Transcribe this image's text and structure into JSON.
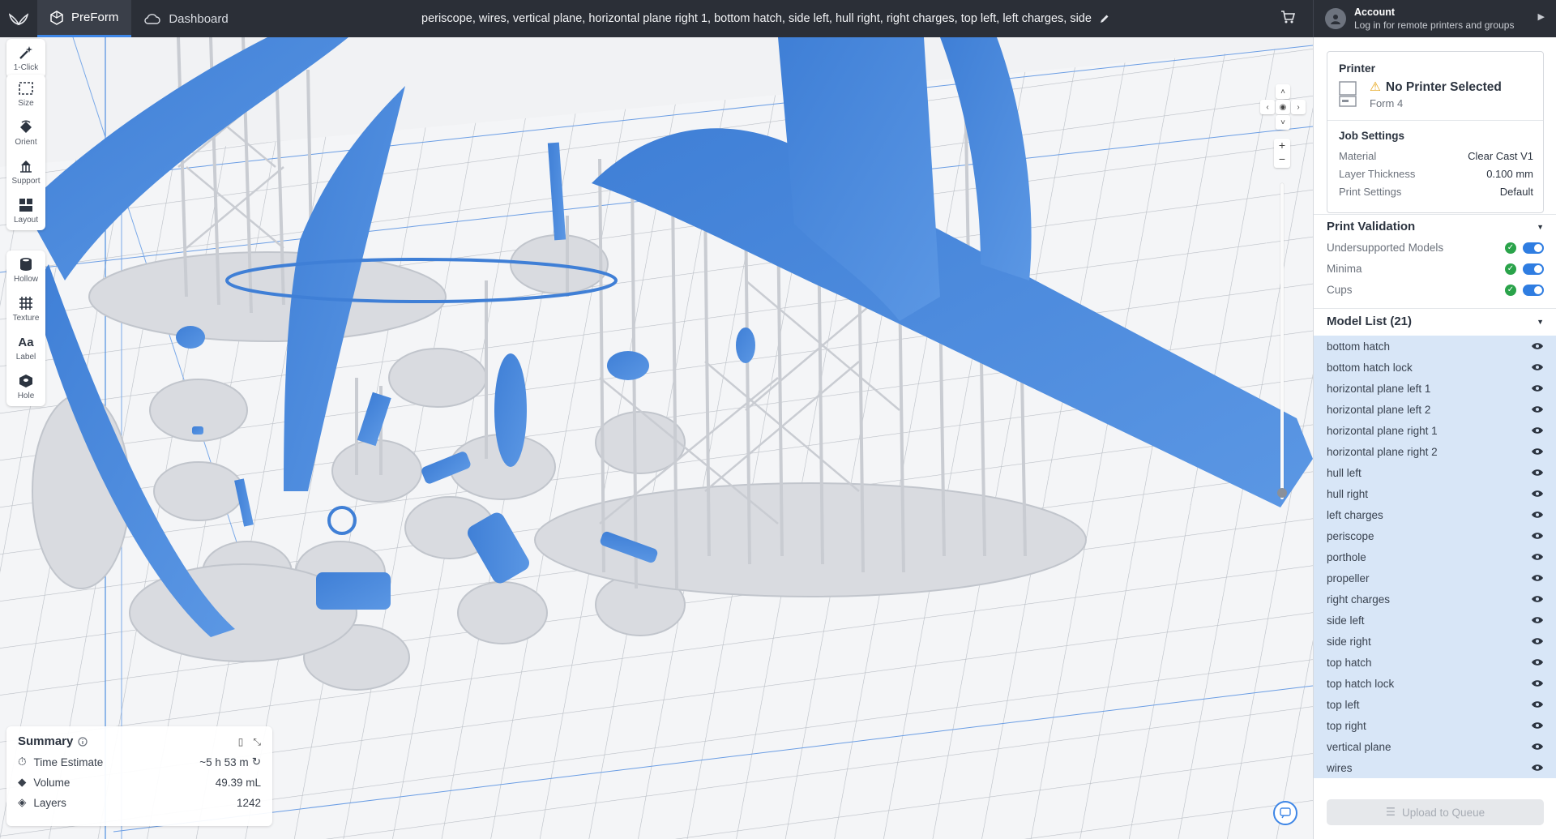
{
  "topbar": {
    "tabs": [
      {
        "label": "PreForm",
        "icon": "preform-cube-icon"
      },
      {
        "label": "Dashboard",
        "icon": "cloud-icon"
      }
    ],
    "document_title": "periscope, wires, vertical plane, horizontal plane right 1, bottom hatch, side left, hull right, right charges, top left, left charges, side",
    "account": {
      "title": "Account",
      "subtitle": "Log in for remote printers and groups"
    }
  },
  "tools": {
    "group1": [
      {
        "label": "1-Click",
        "icon": "magic-wand-icon"
      }
    ],
    "group2": [
      {
        "label": "Size",
        "icon": "size-icon"
      },
      {
        "label": "Orient",
        "icon": "orient-icon"
      },
      {
        "label": "Support",
        "icon": "support-icon"
      },
      {
        "label": "Layout",
        "icon": "layout-icon"
      }
    ],
    "group3": [
      {
        "label": "Hollow",
        "icon": "hollow-icon"
      },
      {
        "label": "Texture",
        "icon": "texture-icon"
      },
      {
        "label": "Label",
        "icon": "label-icon"
      },
      {
        "label": "Hole",
        "icon": "hole-icon"
      }
    ]
  },
  "summary": {
    "title": "Summary",
    "rows": [
      {
        "label": "Time Estimate",
        "value": "~5 h 53 m",
        "icon": "clock-icon"
      },
      {
        "label": "Volume",
        "value": "49.39 mL",
        "icon": "droplet-icon"
      },
      {
        "label": "Layers",
        "value": "1242",
        "icon": "layers-icon"
      }
    ]
  },
  "printer": {
    "heading": "Printer",
    "name": "No Printer Selected",
    "model": "Form 4",
    "job_settings_heading": "Job Settings",
    "job_settings": [
      {
        "label": "Material",
        "value": "Clear Cast V1"
      },
      {
        "label": "Layer Thickness",
        "value": "0.100 mm"
      },
      {
        "label": "Print Settings",
        "value": "Default"
      }
    ]
  },
  "validation": {
    "heading": "Print Validation",
    "items": [
      {
        "label": "Undersupported Models",
        "enabled": true
      },
      {
        "label": "Minima",
        "enabled": true
      },
      {
        "label": "Cups",
        "enabled": true
      }
    ]
  },
  "model_list": {
    "heading": "Model List (21)",
    "items": [
      "bottom hatch",
      "bottom hatch lock",
      "horizontal plane left 1",
      "horizontal plane left 2",
      "horizontal plane right 1",
      "horizontal plane right 2",
      "hull left",
      "hull right",
      "left charges",
      "periscope",
      "porthole",
      "propeller",
      "right charges",
      "side left",
      "side right",
      "top hatch",
      "top hatch lock",
      "top left",
      "top right",
      "vertical plane",
      "wires"
    ]
  },
  "upload_label": "Upload to Queue",
  "colors": {
    "accent": "#3e86e6",
    "model_blue": "#4a86d8",
    "support_gray": "#d3d5da",
    "topbar": "#2b2f37"
  }
}
